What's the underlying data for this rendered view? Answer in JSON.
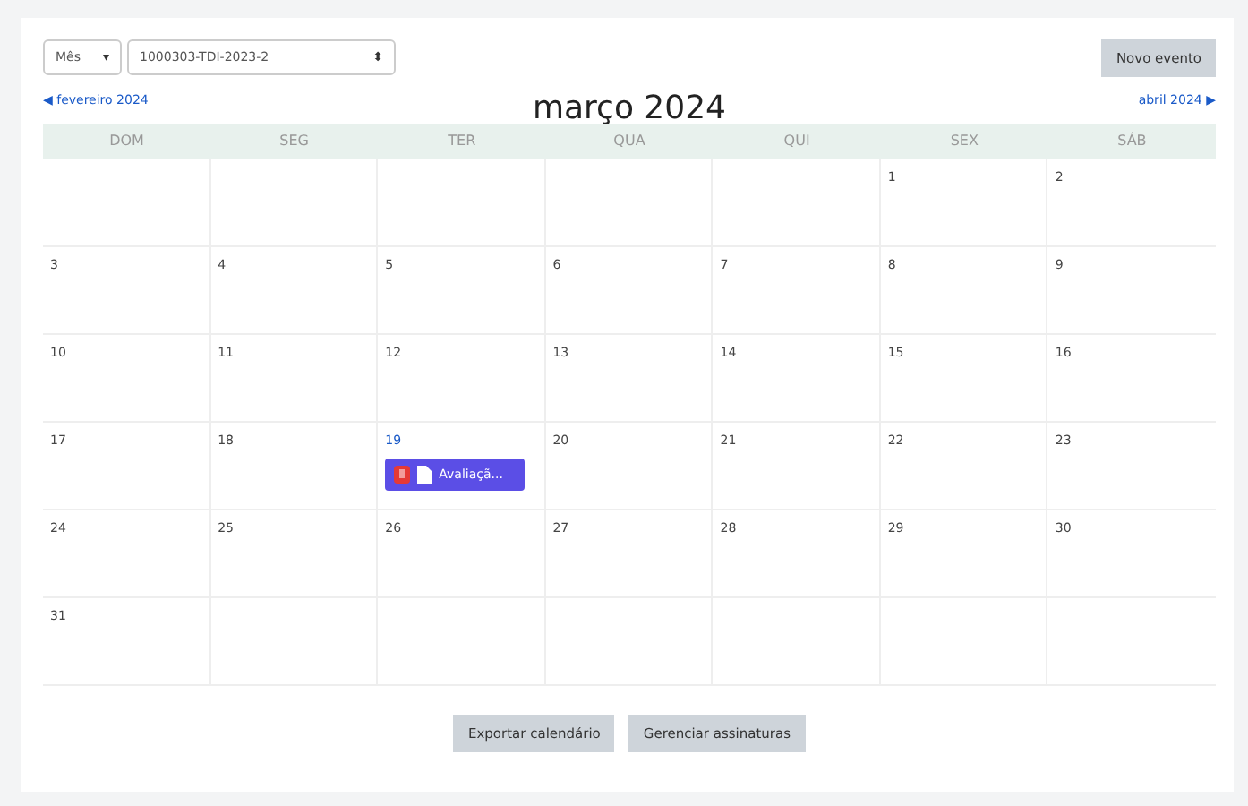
{
  "view_select": {
    "value": "Mês",
    "caret": "▾"
  },
  "course_select": {
    "value": "1000303-TDI-2023-2",
    "caret": "⬍"
  },
  "new_event_button": "Novo evento",
  "prev_month": {
    "arrow": "◀",
    "label": "fevereiro 2024"
  },
  "title": "março 2024",
  "next_month": {
    "arrow": "▶",
    "label": "abril 2024"
  },
  "weekdays": [
    "DOM",
    "SEG",
    "TER",
    "QUA",
    "QUI",
    "SEX",
    "SÁB"
  ],
  "weeks": [
    {
      "kind": "first",
      "days": [
        {
          "day": "1",
          "today": false
        },
        {
          "day": "2",
          "today": false
        }
      ]
    },
    {
      "kind": "full",
      "days": [
        {
          "day": "3",
          "today": false
        },
        {
          "day": "4",
          "today": false
        },
        {
          "day": "5",
          "today": false
        },
        {
          "day": "6",
          "today": false
        },
        {
          "day": "7",
          "today": false
        },
        {
          "day": "8",
          "today": false
        },
        {
          "day": "9",
          "today": false
        }
      ]
    },
    {
      "kind": "full",
      "days": [
        {
          "day": "10",
          "today": false
        },
        {
          "day": "11",
          "today": false
        },
        {
          "day": "12",
          "today": false
        },
        {
          "day": "13",
          "today": false
        },
        {
          "day": "14",
          "today": false
        },
        {
          "day": "15",
          "today": false
        },
        {
          "day": "16",
          "today": false
        }
      ]
    },
    {
      "kind": "full",
      "days": [
        {
          "day": "17",
          "today": false
        },
        {
          "day": "18",
          "today": false
        },
        {
          "day": "19",
          "today": true,
          "events": [
            {
              "label": "Avaliaçã...",
              "color": "#5b4ee6"
            }
          ]
        },
        {
          "day": "20",
          "today": false
        },
        {
          "day": "21",
          "today": false
        },
        {
          "day": "22",
          "today": false
        },
        {
          "day": "23",
          "today": false
        }
      ]
    },
    {
      "kind": "full",
      "days": [
        {
          "day": "24",
          "today": false
        },
        {
          "day": "25",
          "today": false
        },
        {
          "day": "26",
          "today": false
        },
        {
          "day": "27",
          "today": false
        },
        {
          "day": "28",
          "today": false
        },
        {
          "day": "29",
          "today": false
        },
        {
          "day": "30",
          "today": false
        }
      ]
    },
    {
      "kind": "last",
      "days": [
        {
          "day": "31",
          "today": false
        }
      ]
    }
  ],
  "footer_buttons": [
    "Exportar calendário",
    "Gerenciar assinaturas"
  ]
}
